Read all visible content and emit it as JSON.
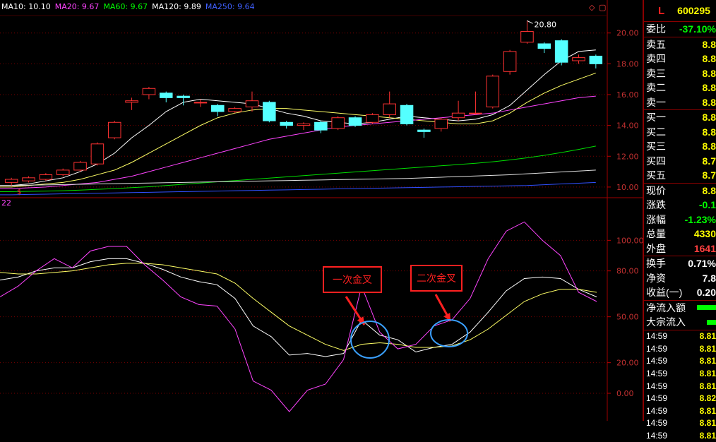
{
  "legend": [
    {
      "text": "MA10: 10.10",
      "color": "#ffffff"
    },
    {
      "text": "MA20: 9.67",
      "color": "#ff44ff"
    },
    {
      "text": "MA60: 9.67",
      "color": "#00ff00"
    },
    {
      "text": "MA120: 9.89",
      "color": "#ffffff"
    },
    {
      "text": "MA250: 9.64",
      "color": "#4060ff"
    }
  ],
  "indicator_label": "22",
  "price_axis": [
    "20.00",
    "18.00",
    "16.00",
    "14.00",
    "12.00",
    "10.00"
  ],
  "indicator_axis": [
    "100.00",
    "80.00",
    "50.00",
    "20.00",
    "0.00"
  ],
  "high_marker": "20.80",
  "annotations": {
    "first": "一次金叉",
    "second": "二次金叉"
  },
  "chart_data": [
    {
      "type": "candlestick",
      "candles": [
        [
          10.3,
          10.5,
          10.1,
          10.6
        ],
        [
          10.4,
          10.6,
          10.3,
          10.7
        ],
        [
          10.5,
          10.8,
          10.4,
          10.9
        ],
        [
          10.8,
          11.1,
          10.7,
          11.2
        ],
        [
          11.1,
          11.6,
          11.0,
          11.7
        ],
        [
          11.5,
          12.8,
          11.4,
          12.9
        ],
        [
          13.2,
          14.2,
          13.1,
          14.3
        ],
        [
          15.5,
          15.6,
          15.0,
          15.8
        ],
        [
          16.0,
          16.4,
          15.7,
          16.5
        ],
        [
          16.1,
          15.8,
          15.5,
          16.2
        ],
        [
          15.9,
          15.8,
          15.3,
          16.0
        ],
        [
          15.5,
          15.5,
          15.2,
          15.7
        ],
        [
          15.3,
          14.9,
          14.6,
          15.4
        ],
        [
          14.9,
          15.1,
          14.8,
          15.2
        ],
        [
          15.2,
          15.6,
          14.9,
          16.2
        ],
        [
          15.5,
          14.3,
          14.2,
          15.6
        ],
        [
          14.2,
          14.0,
          13.8,
          14.3
        ],
        [
          14.0,
          14.1,
          13.7,
          14.2
        ],
        [
          14.2,
          13.7,
          13.5,
          14.3
        ],
        [
          13.8,
          14.5,
          13.7,
          14.6
        ],
        [
          14.5,
          14.0,
          13.9,
          14.6
        ],
        [
          14.2,
          14.7,
          14.1,
          14.8
        ],
        [
          14.7,
          15.4,
          14.5,
          16.2
        ],
        [
          15.3,
          14.1,
          14.0,
          15.4
        ],
        [
          13.7,
          13.6,
          13.2,
          13.8
        ],
        [
          13.8,
          14.4,
          13.6,
          14.5
        ],
        [
          14.5,
          14.8,
          14.3,
          15.6
        ],
        [
          14.8,
          14.8,
          14.7,
          16.2
        ],
        [
          15.2,
          17.2,
          15.1,
          17.3
        ],
        [
          17.5,
          18.8,
          17.3,
          18.9
        ],
        [
          19.4,
          20.1,
          19.3,
          20.8
        ],
        [
          19.3,
          19.0,
          18.7,
          19.4
        ],
        [
          19.5,
          18.1,
          17.9,
          19.6
        ],
        [
          18.2,
          18.4,
          18.0,
          18.6
        ],
        [
          18.5,
          18.0,
          17.7,
          18.6
        ]
      ],
      "ma": [
        {
          "name": "MA10",
          "color": "#ffffff",
          "values": [
            10.1,
            10.2,
            10.4,
            10.6,
            11.0,
            11.5,
            12.2,
            13.2,
            14.0,
            14.9,
            15.5,
            15.7,
            15.6,
            15.5,
            15.4,
            15.1,
            14.8,
            14.6,
            14.3,
            14.2,
            14.1,
            14.2,
            14.4,
            14.6,
            14.5,
            14.4,
            14.3,
            14.4,
            14.7,
            15.3,
            16.3,
            17.3,
            18.2,
            18.8,
            18.9
          ]
        },
        {
          "name": "MA20",
          "color": "#ffff66",
          "values": [
            10.0,
            10.1,
            10.2,
            10.3,
            10.5,
            10.8,
            11.1,
            11.6,
            12.2,
            12.8,
            13.4,
            14.0,
            14.5,
            14.8,
            15.0,
            15.1,
            15.1,
            15.0,
            14.9,
            14.8,
            14.7,
            14.6,
            14.5,
            14.4,
            14.3,
            14.2,
            14.1,
            14.1,
            14.3,
            14.8,
            15.5,
            16.1,
            16.6,
            17.0,
            17.4
          ]
        },
        {
          "name": "MA60",
          "color": "#ff44ff",
          "values": [
            9.9,
            9.95,
            10.0,
            10.1,
            10.2,
            10.3,
            10.5,
            10.7,
            11.0,
            11.3,
            11.6,
            11.9,
            12.2,
            12.5,
            12.8,
            13.1,
            13.3,
            13.5,
            13.7,
            13.9,
            14.0,
            14.1,
            14.2,
            14.3,
            14.4,
            14.5,
            14.6,
            14.7,
            14.8,
            15.0,
            15.2,
            15.4,
            15.6,
            15.8,
            15.9
          ]
        },
        {
          "name": "MA120",
          "color": "#00dd00",
          "values": [
            9.7,
            9.72,
            9.74,
            9.76,
            9.8,
            9.85,
            9.9,
            9.96,
            10.02,
            10.1,
            10.18,
            10.26,
            10.34,
            10.42,
            10.5,
            10.58,
            10.66,
            10.74,
            10.82,
            10.9,
            10.98,
            11.06,
            11.14,
            11.22,
            11.3,
            11.38,
            11.46,
            11.54,
            11.64,
            11.76,
            11.9,
            12.06,
            12.24,
            12.44,
            12.66
          ]
        },
        {
          "name": "MA250",
          "color": "#e0e0e0",
          "values": [
            10.1,
            10.12,
            10.14,
            10.16,
            10.18,
            10.2,
            10.22,
            10.24,
            10.26,
            10.28,
            10.3,
            10.32,
            10.34,
            10.36,
            10.38,
            10.4,
            10.42,
            10.44,
            10.46,
            10.48,
            10.5,
            10.52,
            10.54,
            10.56,
            10.6,
            10.64,
            10.68,
            10.72,
            10.76,
            10.8,
            10.86,
            10.92,
            10.98,
            11.04,
            11.1
          ]
        },
        {
          "name": "MA5",
          "color": "#3050ff",
          "values": [
            9.5,
            9.52,
            9.54,
            9.56,
            9.58,
            9.6,
            9.62,
            9.64,
            9.66,
            9.68,
            9.7,
            9.72,
            9.74,
            9.76,
            9.78,
            9.8,
            9.82,
            9.84,
            9.86,
            9.88,
            9.9,
            9.92,
            9.94,
            9.96,
            9.98,
            10.0,
            10.02,
            10.04,
            10.06,
            10.08,
            10.1,
            10.15,
            10.2,
            10.25,
            10.3
          ]
        }
      ],
      "ylim": [
        9.4,
        21.5
      ]
    },
    {
      "type": "line",
      "series": [
        {
          "name": "K",
          "color": "#ffffff",
          "values": [
            74,
            76,
            80,
            82,
            82,
            86,
            88,
            88,
            85,
            81,
            76,
            73,
            71,
            62,
            44,
            37,
            25,
            26,
            24,
            26,
            48,
            38,
            35,
            27,
            30,
            32,
            40,
            53,
            67,
            75,
            76,
            75,
            68,
            63
          ]
        },
        {
          "name": "D",
          "color": "#ffff66",
          "values": [
            79,
            78,
            78,
            79,
            80,
            82,
            84,
            85,
            85,
            84,
            82,
            80,
            78,
            72,
            62,
            53,
            44,
            38,
            32,
            28,
            32,
            33,
            32,
            30,
            30,
            31,
            35,
            42,
            51,
            60,
            65,
            68,
            68,
            66
          ]
        },
        {
          "name": "J",
          "color": "#ff44ff",
          "values": [
            63,
            70,
            80,
            88,
            82,
            93,
            96,
            96,
            84,
            74,
            63,
            58,
            57,
            42,
            8,
            2,
            -12,
            2,
            6,
            22,
            70,
            40,
            29,
            32,
            44,
            48,
            62,
            88,
            106,
            112,
            100,
            90,
            66,
            60
          ]
        }
      ],
      "ylim": [
        -18,
        126
      ]
    }
  ],
  "panel": {
    "flag": "L",
    "code": "600295",
    "ratio_label": "委比",
    "ratio_value": "-37.10%",
    "orders": [
      {
        "label": "卖五",
        "value": "8.8"
      },
      {
        "label": "卖四",
        "value": "8.8"
      },
      {
        "label": "卖三",
        "value": "8.8"
      },
      {
        "label": "卖二",
        "value": "8.8"
      },
      {
        "label": "卖一",
        "value": "8.8"
      },
      {
        "label": "买一",
        "value": "8.8"
      },
      {
        "label": "买二",
        "value": "8.8"
      },
      {
        "label": "买三",
        "value": "8.8"
      },
      {
        "label": "买四",
        "value": "8.7"
      },
      {
        "label": "买五",
        "value": "8.7"
      }
    ],
    "stats": [
      {
        "label": "现价",
        "value": "8.8",
        "color": "#ffff00"
      },
      {
        "label": "涨跌",
        "value": "-0.1",
        "color": "#00ff00"
      },
      {
        "label": "涨幅",
        "value": "-1.23%",
        "color": "#00ff00"
      },
      {
        "label": "总量",
        "value": "4330",
        "color": "#ffff00"
      },
      {
        "label": "外盘",
        "value": "1641",
        "color": "#ff4040"
      }
    ],
    "stats2": [
      {
        "label": "换手",
        "value": "0.71%",
        "color": "#ffffff"
      },
      {
        "label": "净资",
        "value": "7.8",
        "color": "#ffffff"
      },
      {
        "label": "收益(一)",
        "value": "0.20",
        "color": "#ffffff"
      }
    ],
    "flows": [
      {
        "label": "净流入额",
        "fill": 0.9
      },
      {
        "label": "大宗流入",
        "fill": 0.45
      }
    ],
    "ticks": [
      {
        "time": "14:59",
        "price": "8.81"
      },
      {
        "time": "14:59",
        "price": "8.81"
      },
      {
        "time": "14:59",
        "price": "8.81"
      },
      {
        "time": "14:59",
        "price": "8.81"
      },
      {
        "time": "14:59",
        "price": "8.81"
      },
      {
        "time": "14:59",
        "price": "8.82"
      },
      {
        "time": "14:59",
        "price": "8.81"
      },
      {
        "time": "14:59",
        "price": "8.81"
      },
      {
        "time": "14:59",
        "price": "8.81"
      }
    ]
  }
}
